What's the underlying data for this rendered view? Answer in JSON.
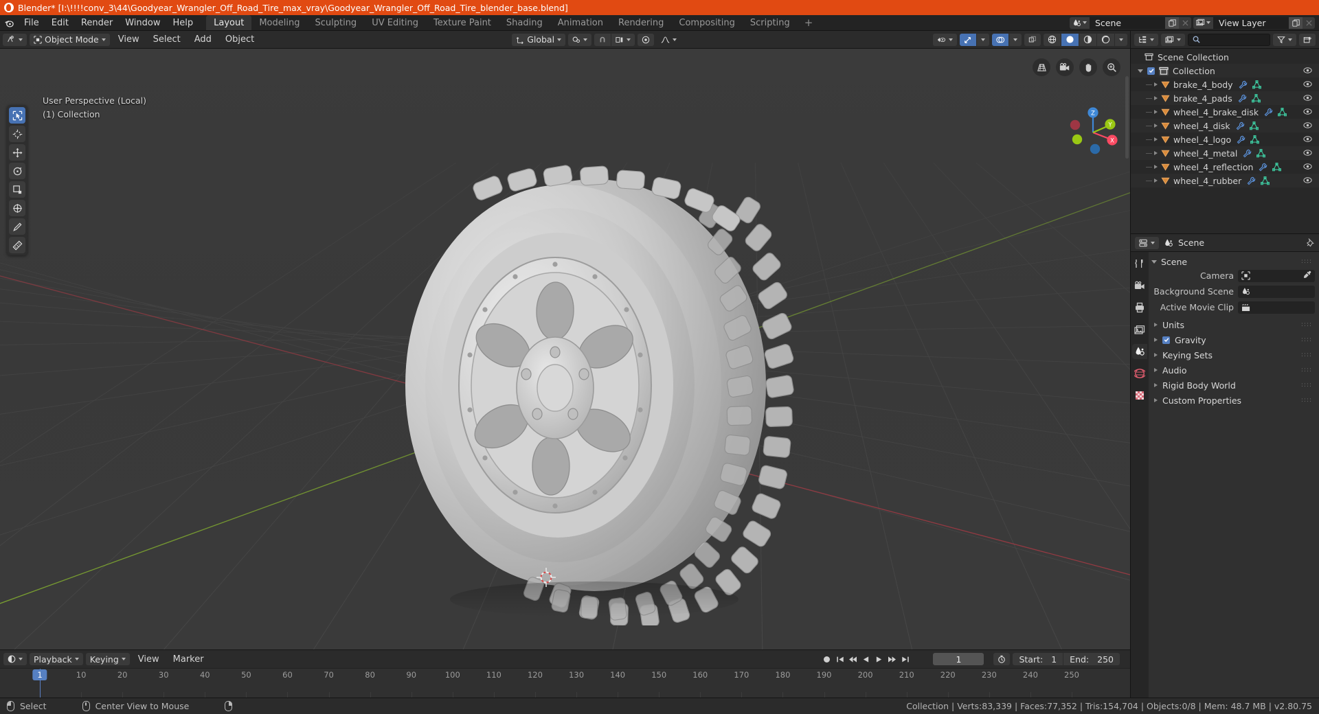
{
  "titlebar": {
    "text": "Blender* [I:\\!!!!conv_3\\44\\Goodyear_Wrangler_Off_Road_Tire_max_vray\\Goodyear_Wrangler_Off_Road_Tire_blender_base.blend]",
    "icon": "blender-logo-icon",
    "accent_color": "#e14a12"
  },
  "topbar": {
    "menus": [
      "File",
      "Edit",
      "Render",
      "Window",
      "Help"
    ],
    "workspaces": [
      {
        "label": "Layout",
        "active": true
      },
      {
        "label": "Modeling",
        "active": false
      },
      {
        "label": "Sculpting",
        "active": false
      },
      {
        "label": "UV Editing",
        "active": false
      },
      {
        "label": "Texture Paint",
        "active": false
      },
      {
        "label": "Shading",
        "active": false
      },
      {
        "label": "Animation",
        "active": false
      },
      {
        "label": "Rendering",
        "active": false
      },
      {
        "label": "Compositing",
        "active": false
      },
      {
        "label": "Scripting",
        "active": false
      }
    ],
    "add_workspace_label": "+",
    "scene": {
      "icon": "scene-icon",
      "name": "Scene",
      "copy_icon": "new-copy-icon",
      "unlink_icon": "unlink-x-icon"
    },
    "view_layer": {
      "icon": "view-layer-icon",
      "name": "View Layer",
      "copy_icon": "new-copy-icon",
      "unlink_icon": "unlink-x-icon"
    }
  },
  "viewport_header": {
    "editor_type_icon": "editor-type-3dview-icon",
    "mode": "Object Mode",
    "mode_icon": "object-mode-icon",
    "menus": [
      "View",
      "Select",
      "Add",
      "Object"
    ],
    "transform_orientation": {
      "icon": "orientation-icon",
      "value": "Global"
    },
    "snap_icon": "snap-magnet-icon",
    "pivot_icon": "pivot-point-icon",
    "proportional_icon": "proportional-edit-icon",
    "falloff_icon": "falloff-curve-icon",
    "visibility_icon": "visibility-eye-icon",
    "gizmo_icon": "gizmo-icon",
    "overlays_icon": "overlays-icon",
    "xray_icon": "xray-toggle-icon",
    "shading_modes": [
      "wireframe",
      "solid",
      "material-preview",
      "rendered"
    ],
    "shading_active": "solid"
  },
  "viewport": {
    "overlay_line1": "User Perspective (Local)",
    "overlay_line2": "(1) Collection",
    "tools": [
      {
        "name": "select-box-tool",
        "active": true
      },
      {
        "name": "cursor-tool",
        "active": false
      },
      {
        "name": "move-tool",
        "active": false
      },
      {
        "name": "rotate-tool",
        "active": false
      },
      {
        "name": "scale-tool",
        "active": false
      },
      {
        "name": "transform-tool",
        "active": false
      },
      {
        "name": "annotate-tool",
        "active": false
      },
      {
        "name": "measure-tool",
        "active": false
      }
    ],
    "nav_buttons": [
      "grid-perspective-icon",
      "camera-view-icon",
      "pan-hand-icon",
      "zoom-magnifier-icon"
    ],
    "axis_labels": {
      "x": "X",
      "y": "Y",
      "z": "Z"
    },
    "axis_colors": {
      "x": "#fc4a62",
      "y": "#9ac814",
      "z": "#3f88d6"
    },
    "object_description": "Goodyear Wrangler off-road tire with alloy wheel, solid grey shading"
  },
  "timeline": {
    "editor_icon": "timeline-editor-icon",
    "menus": [
      "Playback",
      "Keying",
      "View",
      "Marker"
    ],
    "transport": [
      "jump-start-icon",
      "prev-keyframe-icon",
      "play-reverse-icon",
      "play-icon",
      "next-keyframe-icon",
      "jump-end-icon"
    ],
    "record_icon": "auto-keying-record-icon",
    "current_frame": "1",
    "timer_icon": "use-preview-range-icon",
    "start_label": "Start:",
    "start_value": "1",
    "end_label": "End:",
    "end_value": "250",
    "ticks": [
      "1",
      "10",
      "20",
      "30",
      "40",
      "50",
      "60",
      "70",
      "80",
      "90",
      "100",
      "110",
      "120",
      "130",
      "140",
      "150",
      "160",
      "170",
      "180",
      "190",
      "200",
      "210",
      "220",
      "230",
      "240",
      "250"
    ],
    "playhead_frame": "1"
  },
  "outliner": {
    "display_mode_icon": "outliner-display-mode-icon",
    "filter_id_icon": "filter-id-type-icon",
    "search_icon": "search-icon",
    "search_value": "",
    "filter_icon": "filter-funnel-icon",
    "new_collection_icon": "new-collection-icon",
    "scene_collection": {
      "label": "Scene Collection",
      "icon": "collection-icon"
    },
    "collection": {
      "label": "Collection",
      "icon": "collection-icon",
      "checked": true,
      "expanded": true
    },
    "objects": [
      {
        "name": "brake_4_body",
        "icon": "mesh-object-icon",
        "modifier_icon": "wrench-modifier-icon",
        "data_icon": "mesh-data-icon",
        "visible": true
      },
      {
        "name": "brake_4_pads",
        "icon": "mesh-object-icon",
        "modifier_icon": "wrench-modifier-icon",
        "data_icon": "mesh-data-icon",
        "visible": true
      },
      {
        "name": "wheel_4_brake_disk",
        "icon": "mesh-object-icon",
        "modifier_icon": "wrench-modifier-icon",
        "data_icon": "mesh-data-icon",
        "visible": true
      },
      {
        "name": "wheel_4_disk",
        "icon": "mesh-object-icon",
        "modifier_icon": "wrench-modifier-icon",
        "data_icon": "mesh-data-icon",
        "visible": true
      },
      {
        "name": "wheel_4_logo",
        "icon": "mesh-object-icon",
        "modifier_icon": "wrench-modifier-icon",
        "data_icon": "mesh-data-icon",
        "visible": true
      },
      {
        "name": "wheel_4_metal",
        "icon": "mesh-object-icon",
        "modifier_icon": "wrench-modifier-icon",
        "data_icon": "mesh-data-icon",
        "visible": true
      },
      {
        "name": "wheel_4_reflection",
        "icon": "mesh-object-icon",
        "modifier_icon": "wrench-modifier-icon",
        "data_icon": "mesh-data-icon",
        "visible": true
      },
      {
        "name": "wheel_4_rubber",
        "icon": "mesh-object-icon",
        "modifier_icon": "wrench-modifier-icon",
        "data_icon": "mesh-data-icon",
        "visible": true
      }
    ]
  },
  "properties": {
    "editor_icon": "properties-editor-icon",
    "breadcrumb_icon": "scene-properties-icon",
    "breadcrumb": "Scene",
    "pin_icon": "pin-icon",
    "tabs": [
      {
        "name": "tool-tab",
        "icon": "tool-icon",
        "active": false
      },
      {
        "name": "render-tab",
        "icon": "render-camera-icon",
        "active": false
      },
      {
        "name": "output-tab",
        "icon": "output-printer-icon",
        "active": false
      },
      {
        "name": "view-layer-tab",
        "icon": "view-layer-images-icon",
        "active": false
      },
      {
        "name": "scene-tab",
        "icon": "scene-cone-icon",
        "active": true
      },
      {
        "name": "world-tab",
        "icon": "world-globe-icon",
        "active": false
      },
      {
        "name": "texture-tab",
        "icon": "texture-checker-icon",
        "active": false
      }
    ],
    "panel_scene": {
      "title": "Scene",
      "expanded": true,
      "fields": [
        {
          "label": "Camera",
          "value": "",
          "icon": "camera-data-icon",
          "eyedropper": true
        },
        {
          "label": "Background Scene",
          "value": "",
          "icon": "scene-data-icon",
          "eyedropper": false
        },
        {
          "label": "Active Movie Clip",
          "value": "",
          "icon": "movie-clip-icon",
          "eyedropper": false
        }
      ]
    },
    "closed_panels": [
      {
        "label": "Units",
        "checkbox": false
      },
      {
        "label": "Gravity",
        "checkbox": true
      },
      {
        "label": "Keying Sets",
        "checkbox": false
      },
      {
        "label": "Audio",
        "checkbox": false
      },
      {
        "label": "Rigid Body World",
        "checkbox": false
      },
      {
        "label": "Custom Properties",
        "checkbox": false
      }
    ]
  },
  "statusbar": {
    "keymap": [
      {
        "icon": "mouse-left-icon",
        "label": "Select"
      },
      {
        "icon": "mouse-middle-icon",
        "label": "Center View to Mouse"
      },
      {
        "icon": "mouse-right-icon",
        "label": ""
      }
    ],
    "stats": "Collection | Verts:83,339 | Faces:77,352 | Tris:154,704 | Objects:0/8 | Mem: 48.7 MB | v2.80.75"
  }
}
